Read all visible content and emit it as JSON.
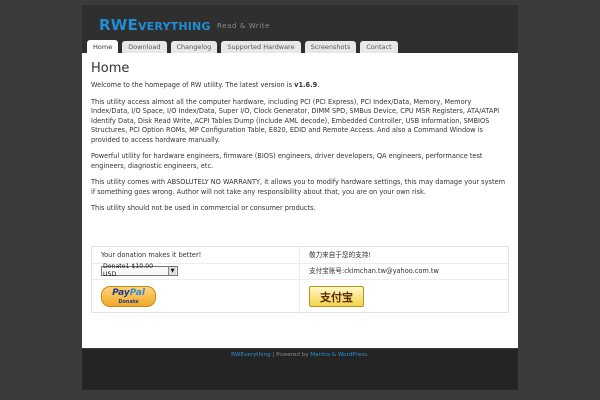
{
  "header": {
    "site_title_big1": "RWE",
    "site_title_small": "VERYTHING",
    "description": "Read & Write"
  },
  "nav": {
    "tabs": [
      {
        "label": "Home",
        "active": true
      },
      {
        "label": "Download"
      },
      {
        "label": "Changelog"
      },
      {
        "label": "Supported Hardware"
      },
      {
        "label": "Screenshots"
      },
      {
        "label": "Contact"
      }
    ]
  },
  "main": {
    "title": "Home",
    "intro_prefix": "Welcome to the homepage of RW utility. The latest version is ",
    "version": "v1.6.9",
    "intro_suffix": ".",
    "p2": "This utility access almost all the computer hardware, including PCI (PCI Express), PCI Index/Data, Memory, Memory Index/Data, I/O Space, I/O Index/Data, Super I/O, Clock Generator, DIMM SPD, SMBus Device, CPU MSR Registers, ATA/ATAPI Identify Data, Disk Read Write, ACPI Tables Dump (include AML decode), Embedded Controller, USB Information, SMBIOS Structures, PCI Option ROMs, MP Configuration Table, E820, EDID and Remote Access. And also a Command Window is provided to access hardware manually.",
    "p3": "Powerful utility for hardware engineers, firmware (BIOS) engineers, driver developers, QA engineers, performance test engineers, diagnostic engineers, etc.",
    "p4": "This utility comes with ABSOLUTELY NO WARRANTY, it allows you to modify hardware settings, this may damage your system if something goes wrong. Author will not take any responsibility about that, you are on your own risk.",
    "p5": "This utility should not be used in commercial or consumer products."
  },
  "donation": {
    "left_header": "Your donation makes it better!",
    "right_header": "敬力来自于您的支持!",
    "select_value": "Donate1 $10.00 USD",
    "alipay_account": "支付宝账号:ckimchan.tw@yahoo.com.tw",
    "paypal_logo_a": "Pay",
    "paypal_logo_b": "Pal",
    "paypal_sub": "Donate",
    "alipay_label": "支付宝"
  },
  "footer": {
    "site_link": "RWEverything",
    "powered_by": " | Powered by ",
    "theme_link": "Mantra & WordPress",
    "end": "."
  },
  "colors": {
    "accent": "#1f8ed6",
    "page_bg": "#3b3b3b"
  }
}
